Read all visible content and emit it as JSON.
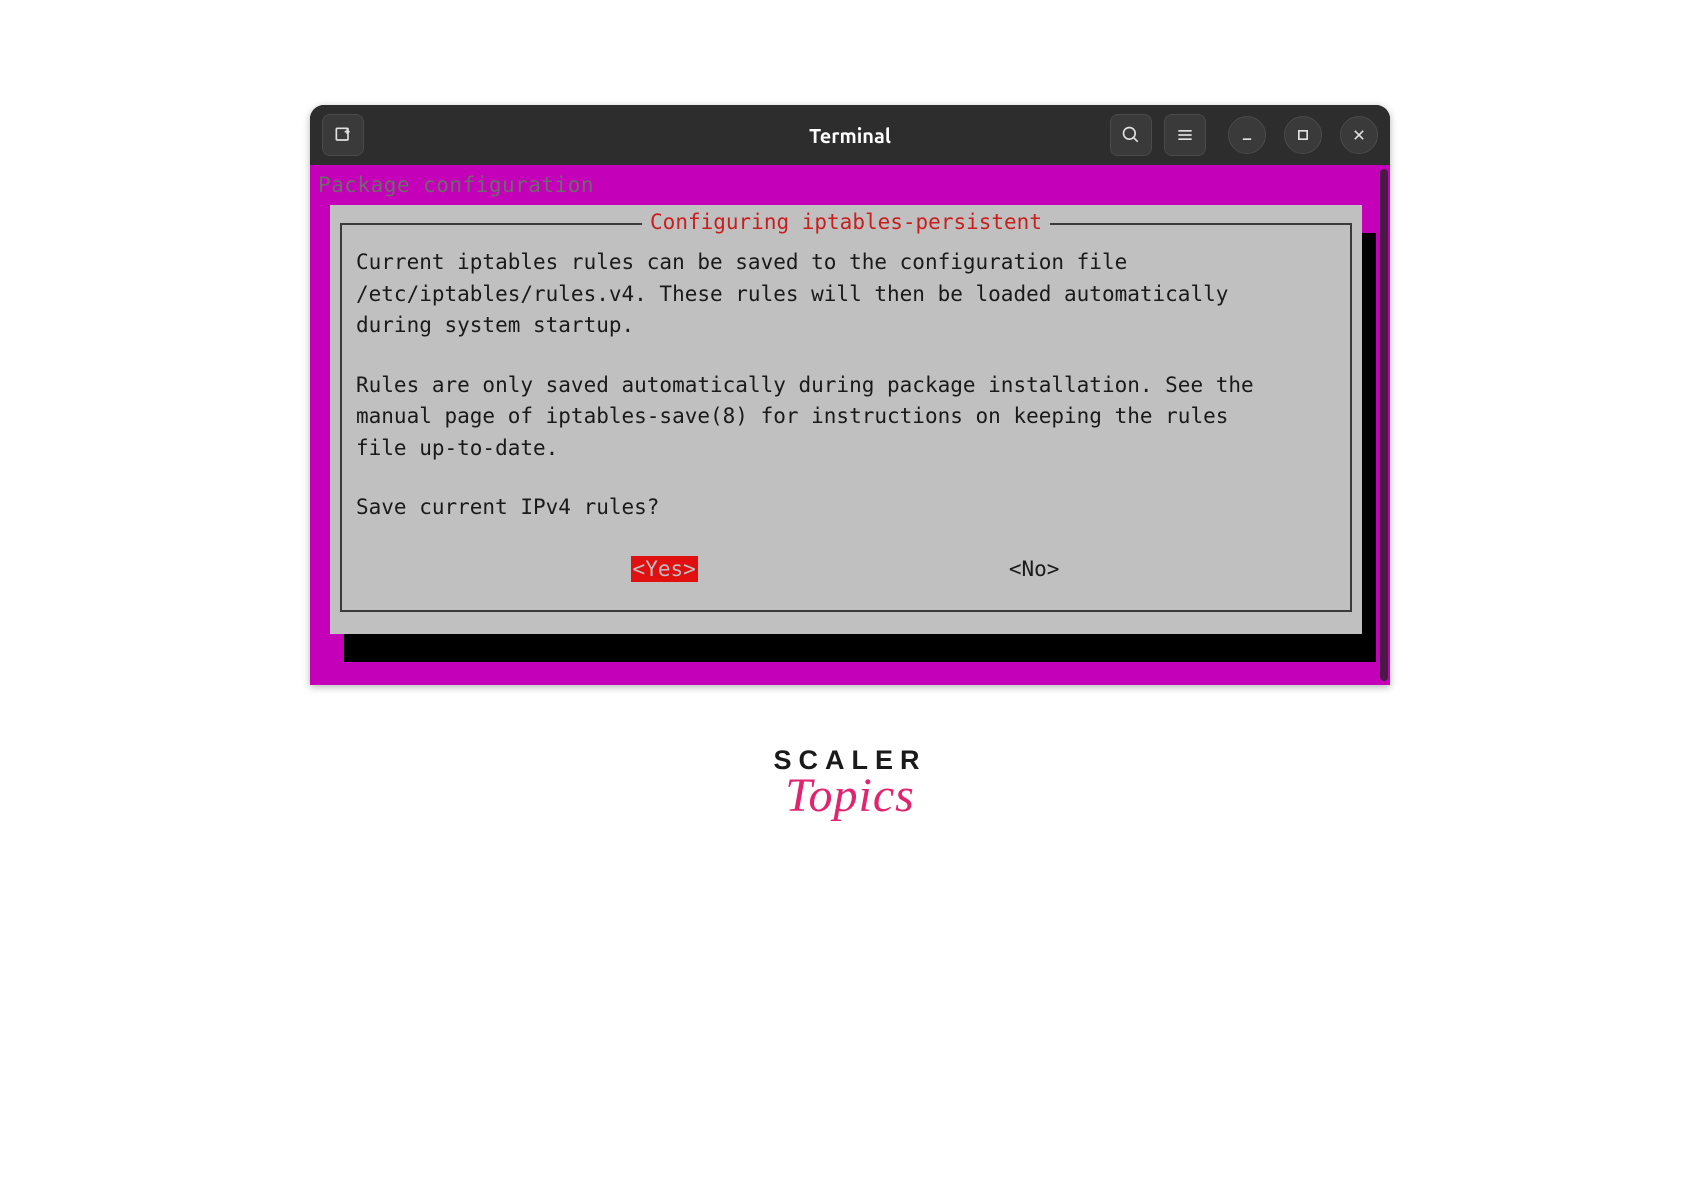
{
  "titlebar": {
    "title": "Terminal"
  },
  "terminal": {
    "header": "Package configuration",
    "dialog": {
      "title": "Configuring iptables-persistent",
      "paragraph1": "Current iptables rules can be saved to the configuration file\n/etc/iptables/rules.v4. These rules will then be loaded automatically\nduring system startup.",
      "paragraph2": "Rules are only saved automatically during package installation. See the\nmanual page of iptables-save(8) for instructions on keeping the rules\nfile up-to-date.",
      "question": "Save current IPv4 rules?",
      "yes_label": "<Yes>",
      "no_label": "<No>"
    }
  },
  "logo": {
    "line1": "SCALER",
    "line2": "Topics"
  }
}
